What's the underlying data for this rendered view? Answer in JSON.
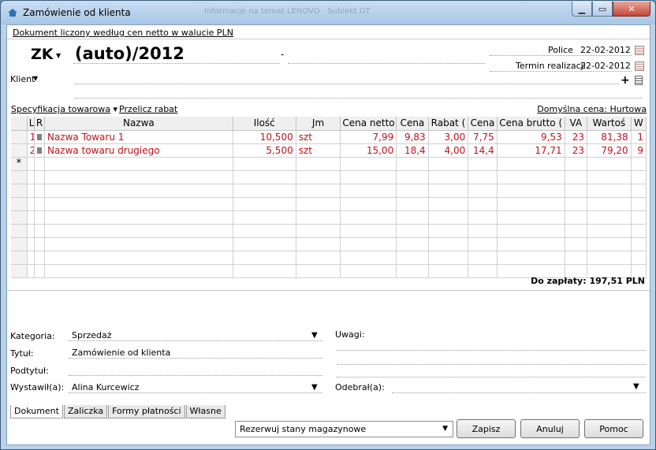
{
  "window": {
    "title": "Zamówienie od klienta",
    "ghost_title": "Informacje na temat LENOVO · Subiekt GT"
  },
  "info_link": "Dokument liczony według cen netto w walucie PLN",
  "header": {
    "doc_type": "ZK",
    "doc_number": "(auto)/2012",
    "dash": "-",
    "city_label": "Police",
    "date_value": "22-02-2012",
    "term_label": "Termin realizacji",
    "term_value": "22-02-2012",
    "client_label": "Klient"
  },
  "spec": {
    "label": "Specyfikacja towarowa",
    "recalc": "Przelicz rabat",
    "default_price": "Domyślna cena: Hurtowa"
  },
  "table": {
    "columns": [
      "L",
      "R",
      "Nazwa",
      "Ilość",
      "Jm",
      "Cena netto",
      "Cena",
      "Rabat (",
      "Cena",
      "Cena brutto (",
      "VA",
      "Wartoś",
      "W"
    ],
    "rows": [
      [
        "1",
        "",
        "Nazwa Towaru 1",
        "10,500",
        "szt",
        "7,99",
        "9,83",
        "3,00",
        "7,75",
        "9,53",
        "23",
        "81,38",
        "1"
      ],
      [
        "2",
        "",
        "Nazwa towaru drugiego",
        "5,500",
        "szt",
        "15,00",
        "18,4",
        "4,00",
        "14,4",
        "17,71",
        "23",
        "79,20",
        "9"
      ]
    ],
    "new_row_marker": "*"
  },
  "total": "Do zapłaty: 197,51 PLN",
  "form": {
    "category_label": "Kategoria:",
    "category_value": "Sprzedaż",
    "title_label": "Tytuł:",
    "title_value": "Zamówienie od klienta",
    "subtitle_label": "Podtytuł:",
    "issued_label": "Wystawił(a):",
    "issued_value": "Alina Kurcewicz",
    "notes_label": "Uwagi:",
    "received_label": "Odebrał(a):"
  },
  "tabs": [
    "Dokument",
    "Zaliczka",
    "Formy płatności",
    "Własne"
  ],
  "footer": {
    "reserve": "Rezerwuj stany magazynowe",
    "save": "Zapisz",
    "cancel": "Anuluj",
    "help": "Pomoc"
  }
}
